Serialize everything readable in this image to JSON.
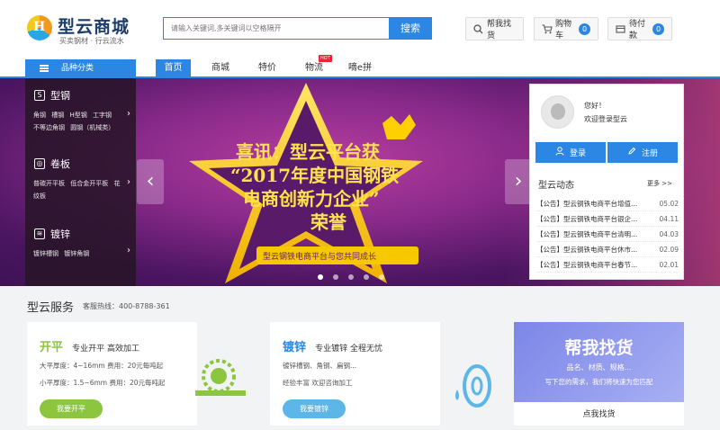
{
  "header": {
    "logo_title": "型云商城",
    "logo_tagline": "买卖钢材 · 行云流水",
    "search_placeholder": "请输入关键词,多关键词以空格隔开",
    "search_button": "搜索",
    "help_find": "帮我找货",
    "cart_label": "购物车",
    "cart_count": "0",
    "pending_label": "待付款",
    "pending_count": "0"
  },
  "nav": {
    "category_label": "品种分类",
    "items": [
      "首页",
      "商城",
      "特价",
      "物流",
      "嘀e拼"
    ],
    "hot_badge": "HOT"
  },
  "categories": [
    {
      "title": "型钢",
      "links": [
        "角钢",
        "槽钢",
        "H型钢",
        "工字钢",
        "不等边角钢",
        "圆钢（机械类）"
      ]
    },
    {
      "title": "卷板",
      "links": [
        "普碳开平板",
        "低合金开平板",
        "花纹板"
      ]
    },
    {
      "title": "镀锌",
      "links": [
        "镀锌槽钢",
        "镀锌角钢"
      ]
    }
  ],
  "banner": {
    "headline_1": "喜讯：型云平台获",
    "headline_2": "“2017年度中国钢铁",
    "headline_3": "电商创新力企业”",
    "headline_4": "荣誉",
    "ribbon": "型云钢铁电商平台与您共同成长"
  },
  "login": {
    "greeting": "您好！",
    "welcome": "欢迎登录型云",
    "login_button": "登录",
    "register_button": "注册",
    "news_title": "型云动态",
    "news_more": "更多 >>",
    "news": [
      {
        "title": "【公告】型云钢铁电商平台增值...",
        "date": "05.02"
      },
      {
        "title": "【公告】型云钢铁电商平台银企...",
        "date": "04.11"
      },
      {
        "title": "【公告】型云钢铁电商平台清明...",
        "date": "04.03"
      },
      {
        "title": "【公告】型云钢铁电商平台休市...",
        "date": "02.09"
      },
      {
        "title": "【公告】型云钢铁电商平台春节...",
        "date": "02.01"
      }
    ]
  },
  "services": {
    "title": "型云服务",
    "hotline": "客服热线：400-8788-361",
    "kaiping": {
      "name": "开平",
      "slogan": "专业开平 高效加工",
      "line1": "大平厚度：4~16mm 费用：20元每吨起",
      "line2": "小平厚度：1.5~6mm 费用：20元每吨起",
      "button": "我要开平"
    },
    "duxin": {
      "name": "镀锌",
      "slogan": "专业镀锌 全程无忧",
      "line1": "镀锌槽钢、角钢、扁钢...",
      "line2": "经验丰富 欢迎咨询加工",
      "button": "我要镀锌"
    },
    "find": {
      "title": "帮我找货",
      "line1": "品名、材质、规格...",
      "line2": "写下您的需求，我们将快速为您匹配",
      "label": "点我找货"
    }
  },
  "colors": {
    "accent": "#2b87e3",
    "green": "#8cc63f",
    "teal": "#5cb6e8",
    "purple": "#7c86e8"
  }
}
